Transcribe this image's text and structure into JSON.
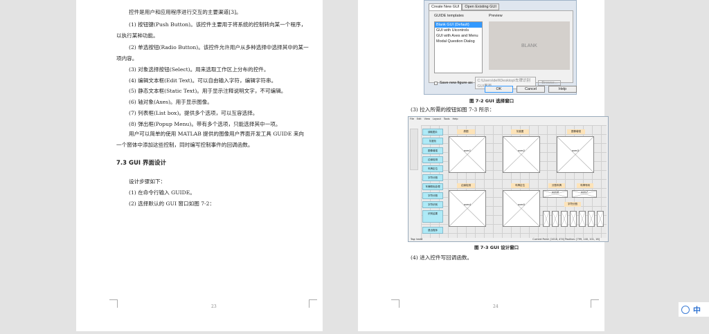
{
  "left_page": {
    "lines": [
      "控件是用户和应用程序进行交互的主要渠道[3]。",
      "(1) 按钮键(Push Button)。该控件主要用于将系统的控制转向某一个程序，",
      "以执行某种功能。",
      "(2) 单选按钮(Radio Button)。该控件允许用户从多种选择中选择其中的某一",
      "项内容。",
      "(3) 对象选择按钮(Select)。用来选取工作区上分布的控件。",
      "(4) 编辑文本框(Edit Text)。可以自由输入字符，编辑字符串。",
      "(5) 静态文本框(Static Text)。用于显示注释说明文字，不可编辑。",
      "(6) 轴对象(Axes)。用于显示图像。",
      "(7) 列表框(List box)。提供多个选项，可以互容选择。",
      "(8) 弹出框(Popup Menu)。带有多个选项，只能选择其中一项。",
      "用户可以简单的使用 MATLAB 提供的图像用户界面开发工具 GUIDE 来向",
      "一个窗体中添加这些控制，同时编写控制事件的回调函数。"
    ],
    "heading": "7.3 GUI 界面设计",
    "steps": [
      "设计步骤如下：",
      "(1) 在命令行输入 GUIDE。",
      "(2) 选择默认的 GUI 窗口如图 7-2："
    ],
    "page_number": "23"
  },
  "right_page": {
    "dialog": {
      "tabs": [
        "Create New GUI",
        "Open Existing GUI"
      ],
      "templates_label": "GUIDE templates",
      "templates": [
        "Blank GUI (Default)",
        "GUI with Uicontrols",
        "GUI with Axes and Menu",
        "Modal Question Dialog"
      ],
      "preview_label": "Preview",
      "preview_text": "BLANK",
      "save_label": "Save new figure as:",
      "save_path": "C:\\Users\\dell\\Desktop\\车牌识别GUI界面",
      "browse": "Browse...",
      "ok": "OK",
      "cancel": "Cancel",
      "help": "Help"
    },
    "caption1": "图 7-2 GUI 选择窗口",
    "step3": "(3) 拉入所需的按钮如图 7-3 所示：",
    "gui": {
      "menu": [
        "File",
        "Edit",
        "View",
        "Layout",
        "Tools",
        "Help"
      ],
      "buttons": [
        "读取图片",
        "灰度化",
        "图像增强",
        "边缘检测",
        "车牌定位",
        "字符分割",
        "车牌颜色处理",
        "字符分割",
        "字符识别",
        "识别结果",
        "退出程序"
      ],
      "labels": [
        "原图",
        "灰度图",
        "图像增强",
        "边缘检测",
        "车牌定位",
        "分割车牌",
        "车牌号码",
        "字符分割"
      ],
      "axes": [
        "axes1",
        "axes2",
        "axes3",
        "axes4",
        "axes5",
        "axes6",
        "axes7",
        "axes8"
      ],
      "tag": "Tag: text8",
      "status": "Current Point: [1018, 474]   Position: [799, 140, 101, 16]"
    },
    "caption2": "图 7-3 GUI 设计窗口",
    "step4": "(4) 进入控件写回调函数。",
    "page_number": "24"
  },
  "widget": {
    "label": "中"
  }
}
